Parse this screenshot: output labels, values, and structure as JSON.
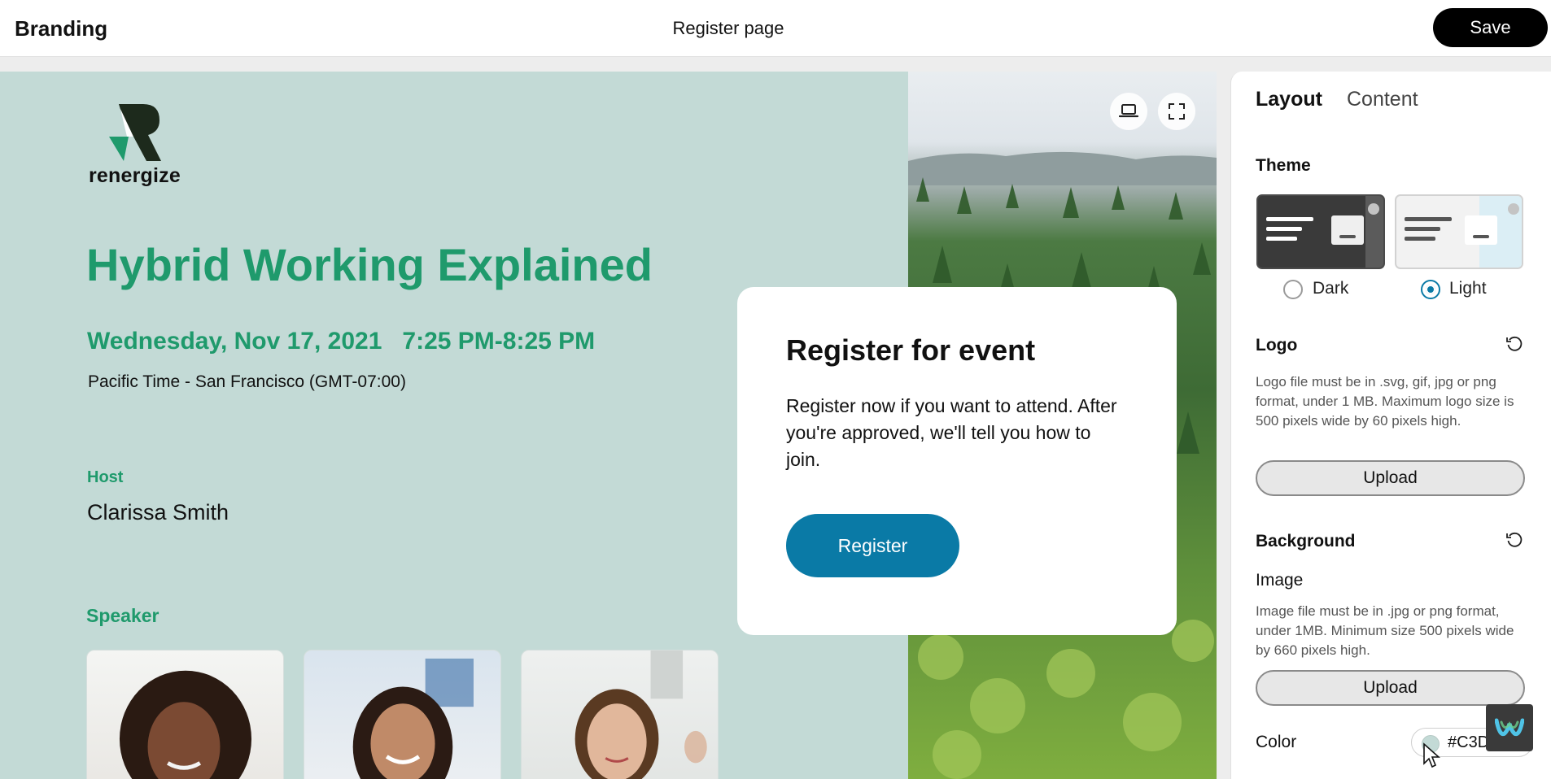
{
  "topbar": {
    "app_title": "Branding",
    "page_name": "Register page",
    "save_label": "Save"
  },
  "preview": {
    "logo_text": "renergize",
    "event_title": "Hybrid Working Explained",
    "event_date": "Wednesday, Nov 17, 2021   7:25 PM-8:25 PM",
    "event_timezone": "Pacific Time - San Francisco (GMT-07:00)",
    "host_label": "Host",
    "host_name": "Clarissa Smith",
    "speaker_label": "Speaker",
    "register_card": {
      "title": "Register for event",
      "text": "Register now if you want to attend. After you're approved, we'll tell you how to join.",
      "button_label": "Register"
    }
  },
  "settings": {
    "tabs": [
      {
        "label": "Layout",
        "active": true
      },
      {
        "label": "Content",
        "active": false
      }
    ],
    "theme": {
      "title": "Theme",
      "options": [
        {
          "label": "Dark",
          "selected": false
        },
        {
          "label": "Light",
          "selected": true
        }
      ]
    },
    "logo": {
      "title": "Logo",
      "help": "Logo file must be in .svg, gif, jpg or png format, under 1 MB. Maximum logo size is 500 pixels wide by 60 pixels high.",
      "upload_label": "Upload"
    },
    "background": {
      "title": "Background",
      "image_label": "Image",
      "help": "Image file must be in .jpg or png format, under 1MB. Minimum size 500 pixels wide by 660 pixels high.",
      "upload_label": "Upload",
      "color_label": "Color",
      "color_value": "#C3DAD6"
    }
  },
  "colors": {
    "accent_green": "#1f9a6c",
    "register_blue": "#0a7aa6",
    "background": "#c3dad6"
  }
}
